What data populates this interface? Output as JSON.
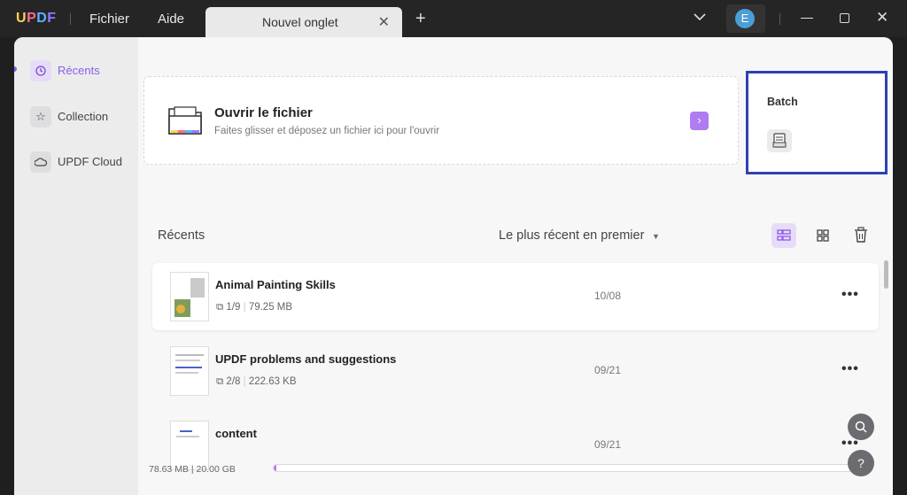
{
  "app": {
    "logo": "UPDF",
    "menu": [
      "Fichier",
      "Aide"
    ]
  },
  "tab": {
    "label": "Nouvel onglet"
  },
  "user": {
    "initial": "E"
  },
  "sidebar": {
    "items": [
      {
        "label": "Récents",
        "icon": "clock-icon",
        "active": true
      },
      {
        "label": "Collection",
        "icon": "star-icon",
        "active": false
      },
      {
        "label": "UPDF Cloud",
        "icon": "cloud-icon",
        "active": false
      }
    ]
  },
  "open_file": {
    "title": "Ouvrir le fichier",
    "subtitle": "Faites glisser et déposez un fichier ici pour l'ouvrir"
  },
  "batch": {
    "title": "Batch"
  },
  "recent": {
    "heading": "Récents",
    "sort_label": "Le plus récent en premier"
  },
  "files": [
    {
      "name": "Animal Painting Skills",
      "pages": "1/9",
      "size": "79.25 MB",
      "date": "10/08"
    },
    {
      "name": "UPDF problems and suggestions",
      "pages": "2/8",
      "size": "222.63 KB",
      "date": "09/21"
    },
    {
      "name": "content",
      "pages": "",
      "size": "",
      "date": "09/21"
    }
  ],
  "storage": {
    "label": "78.63 MB | 20.00 GB",
    "used_fraction": 0.004
  },
  "colors": {
    "accent": "#8c5ce6",
    "highlight_border": "#2f3fb3"
  }
}
